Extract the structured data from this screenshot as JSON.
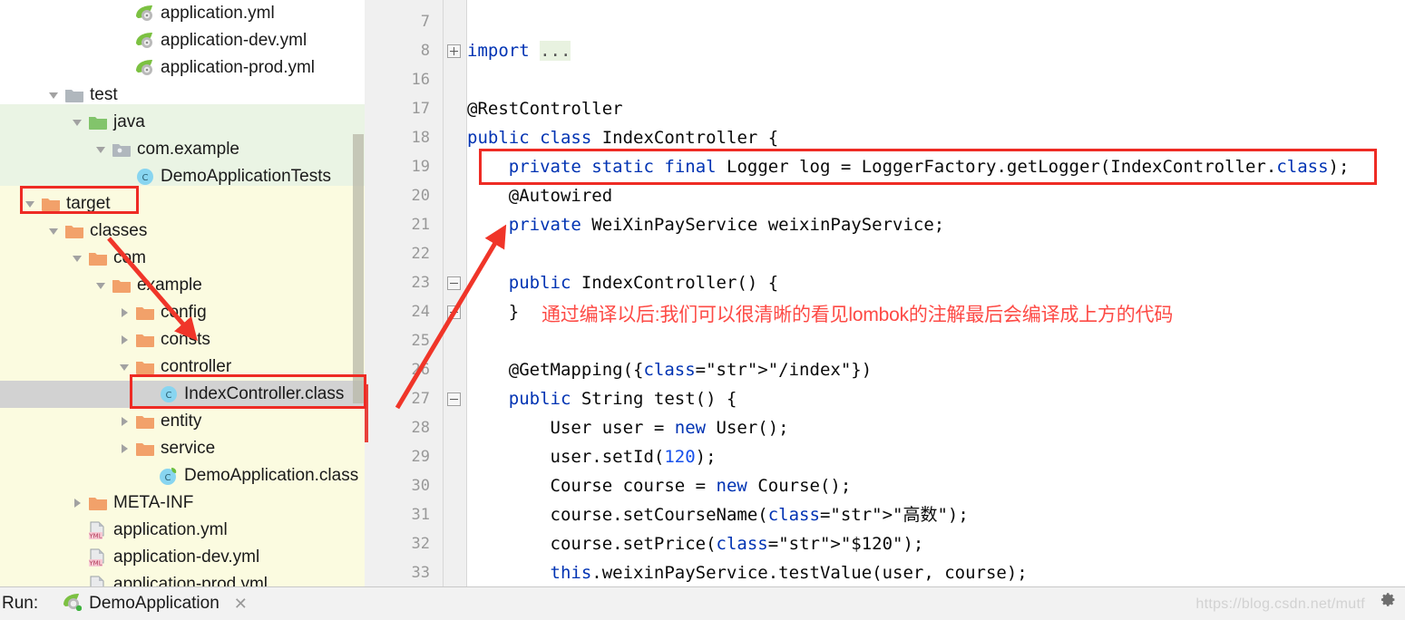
{
  "project_tree": {
    "scroll_position": "middle",
    "rows": [
      {
        "label": "application.yml",
        "indent": 4,
        "twisty": "none",
        "icon": "spring-yaml-icon",
        "zone": "white",
        "selected": false
      },
      {
        "label": "application-dev.yml",
        "indent": 4,
        "twisty": "none",
        "icon": "spring-yaml-icon",
        "zone": "white",
        "selected": false
      },
      {
        "label": "application-prod.yml",
        "indent": 4,
        "twisty": "none",
        "icon": "spring-yaml-icon",
        "zone": "white",
        "selected": false
      },
      {
        "label": "test",
        "indent": 1,
        "twisty": "expanded",
        "icon": "folder-gray-icon",
        "zone": "white",
        "selected": false
      },
      {
        "label": "java",
        "indent": 2,
        "twisty": "expanded",
        "icon": "folder-green-icon",
        "zone": "green",
        "selected": false
      },
      {
        "label": "com.example",
        "indent": 3,
        "twisty": "expanded",
        "icon": "package-gray-icon",
        "zone": "green",
        "selected": false
      },
      {
        "label": "DemoApplicationTests",
        "indent": 4,
        "twisty": "none",
        "icon": "class-icon",
        "zone": "green",
        "selected": false
      },
      {
        "label": "target",
        "indent": 0,
        "twisty": "expanded",
        "icon": "folder-orange-icon",
        "zone": "yellow",
        "selected": false
      },
      {
        "label": "classes",
        "indent": 1,
        "twisty": "expanded",
        "icon": "folder-orange-icon",
        "zone": "yellow",
        "selected": false
      },
      {
        "label": "com",
        "indent": 2,
        "twisty": "expanded",
        "icon": "folder-orange-icon",
        "zone": "yellow",
        "selected": false
      },
      {
        "label": "example",
        "indent": 3,
        "twisty": "expanded",
        "icon": "folder-orange-icon",
        "zone": "yellow",
        "selected": false
      },
      {
        "label": "config",
        "indent": 4,
        "twisty": "collapsed",
        "icon": "folder-orange-icon",
        "zone": "yellow",
        "selected": false
      },
      {
        "label": "consts",
        "indent": 4,
        "twisty": "collapsed",
        "icon": "folder-orange-icon",
        "zone": "yellow",
        "selected": false
      },
      {
        "label": "controller",
        "indent": 4,
        "twisty": "expanded",
        "icon": "folder-orange-icon",
        "zone": "yellow",
        "selected": false
      },
      {
        "label": "IndexController.class",
        "indent": 5,
        "twisty": "none",
        "icon": "class-icon",
        "zone": "yellow",
        "selected": true
      },
      {
        "label": "entity",
        "indent": 4,
        "twisty": "collapsed",
        "icon": "folder-orange-icon",
        "zone": "yellow",
        "selected": false
      },
      {
        "label": "service",
        "indent": 4,
        "twisty": "collapsed",
        "icon": "folder-orange-icon",
        "zone": "yellow",
        "selected": false
      },
      {
        "label": "DemoApplication.class",
        "indent": 5,
        "twisty": "none",
        "icon": "class-spring-icon",
        "zone": "yellow",
        "selected": false
      },
      {
        "label": "META-INF",
        "indent": 2,
        "twisty": "collapsed",
        "icon": "folder-orange-icon",
        "zone": "yellow",
        "selected": false
      },
      {
        "label": "application.yml",
        "indent": 2,
        "twisty": "none",
        "icon": "yml-file-icon",
        "zone": "yellow",
        "selected": false
      },
      {
        "label": "application-dev.yml",
        "indent": 2,
        "twisty": "none",
        "icon": "yml-file-icon",
        "zone": "yellow",
        "selected": false
      },
      {
        "label": "application-prod.yml",
        "indent": 2,
        "twisty": "none",
        "icon": "yml-file-icon",
        "zone": "yellow",
        "selected": false
      }
    ]
  },
  "editor": {
    "line_numbers": [
      "7",
      "8",
      "16",
      "17",
      "18",
      "19",
      "20",
      "21",
      "22",
      "23",
      "24",
      "25",
      "26",
      "27",
      "28",
      "29",
      "30",
      "31",
      "32",
      "33"
    ],
    "lines": [
      {
        "num": "7",
        "text": ""
      },
      {
        "num": "8",
        "text": "import ..."
      },
      {
        "num": "16",
        "text": ""
      },
      {
        "num": "17",
        "text": "@RestController"
      },
      {
        "num": "18",
        "text": "public class IndexController {"
      },
      {
        "num": "19",
        "text": "    private static final Logger log = LoggerFactory.getLogger(IndexController.class);"
      },
      {
        "num": "20",
        "text": "    @Autowired"
      },
      {
        "num": "21",
        "text": "    private WeiXinPayService weixinPayService;"
      },
      {
        "num": "22",
        "text": ""
      },
      {
        "num": "23",
        "text": "    public IndexController() {"
      },
      {
        "num": "24",
        "text": "    }"
      },
      {
        "num": "25",
        "text": ""
      },
      {
        "num": "26",
        "text": "    @GetMapping({\"/index\"})"
      },
      {
        "num": "27",
        "text": "    public String test() {"
      },
      {
        "num": "28",
        "text": "        User user = new User();"
      },
      {
        "num": "29",
        "text": "        user.setId(120);"
      },
      {
        "num": "30",
        "text": "        Course course = new Course();"
      },
      {
        "num": "31",
        "text": "        course.setCourseName(\"高数\");"
      },
      {
        "num": "32",
        "text": "        course.setPrice(\"$120\");"
      },
      {
        "num": "33",
        "text": "        this.weixinPayService.testValue(user, course);"
      }
    ],
    "fold_placeholder": "..."
  },
  "annotations": {
    "note_text": "通过编译以后:我们可以很清晰的看见lombok的注解最后会编译成上方的代码",
    "note_color": "#fd4a45",
    "box_color": "#ee2b24",
    "boxes": [
      "target-row-box",
      "index-controller-row-box",
      "logger-line-box"
    ],
    "arrow": "red-arrow-from-indexcontroller-class-to-code"
  },
  "run_bar": {
    "label": "Run:",
    "tab_name": "DemoApplication",
    "close_label": "✕",
    "watermark": "https://blog.csdn.net/mutf",
    "gear_icon": "gear-icon"
  },
  "colors": {
    "zone_test_sources": "#eaf4e4",
    "zone_target_excluded": "#fbfbe0",
    "selection_gray": "#d2d2d2",
    "keyword_blue": "#0033b3",
    "string_green": "#067d17",
    "number_blue": "#1750eb",
    "gutter_gray": "#f0f0f0",
    "annotation_red": "#ee2b24"
  }
}
